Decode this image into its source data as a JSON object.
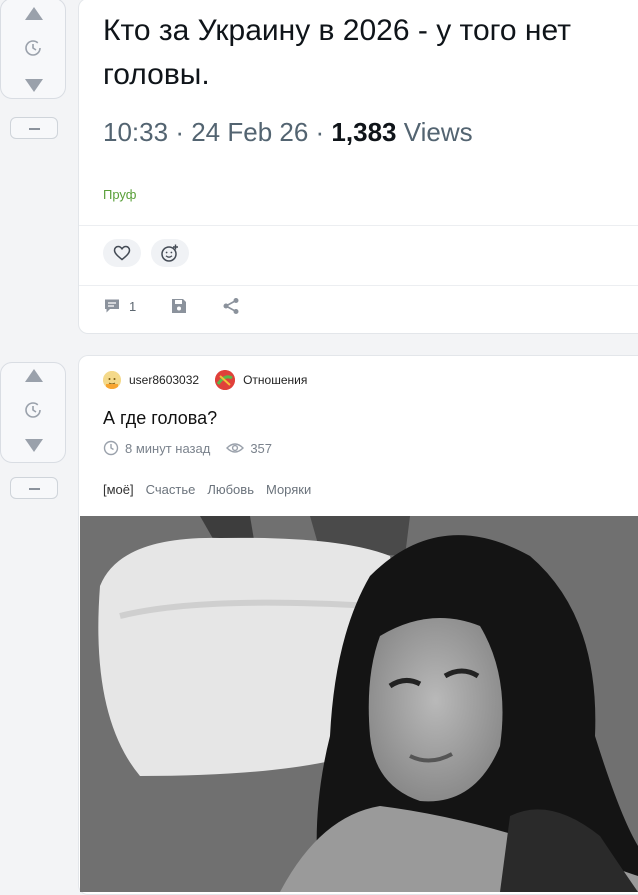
{
  "post1": {
    "tweet_text": "Кто за Украину в 2026 - у того нет головы.",
    "time": "10:33",
    "date": "24 Feb 26",
    "views_count": "1,383",
    "views_label": "Views",
    "proof_link": "Пруф",
    "comments_count": "1"
  },
  "post2": {
    "username": "user8603032",
    "community": "Отношения",
    "title": "А где голова?",
    "time_ago": "8 минут назад",
    "views": "357",
    "tags": [
      "[моё]",
      "Счастье",
      "Любовь",
      "Моряки"
    ]
  },
  "icons": {
    "upvote": "triangle-up-icon",
    "downvote": "triangle-down-icon",
    "save_for_later": "clock-icon",
    "collapse": "minus-icon",
    "like": "heart-icon",
    "add_reaction": "smiley-plus-icon",
    "comments": "comment-icon",
    "save": "floppy-icon",
    "share": "share-icon",
    "time": "clock-icon",
    "views": "eye-icon"
  },
  "colors": {
    "proof_link": "#5aa03a",
    "community_badge": "#e0403a",
    "muted_text": "#7a828c"
  }
}
